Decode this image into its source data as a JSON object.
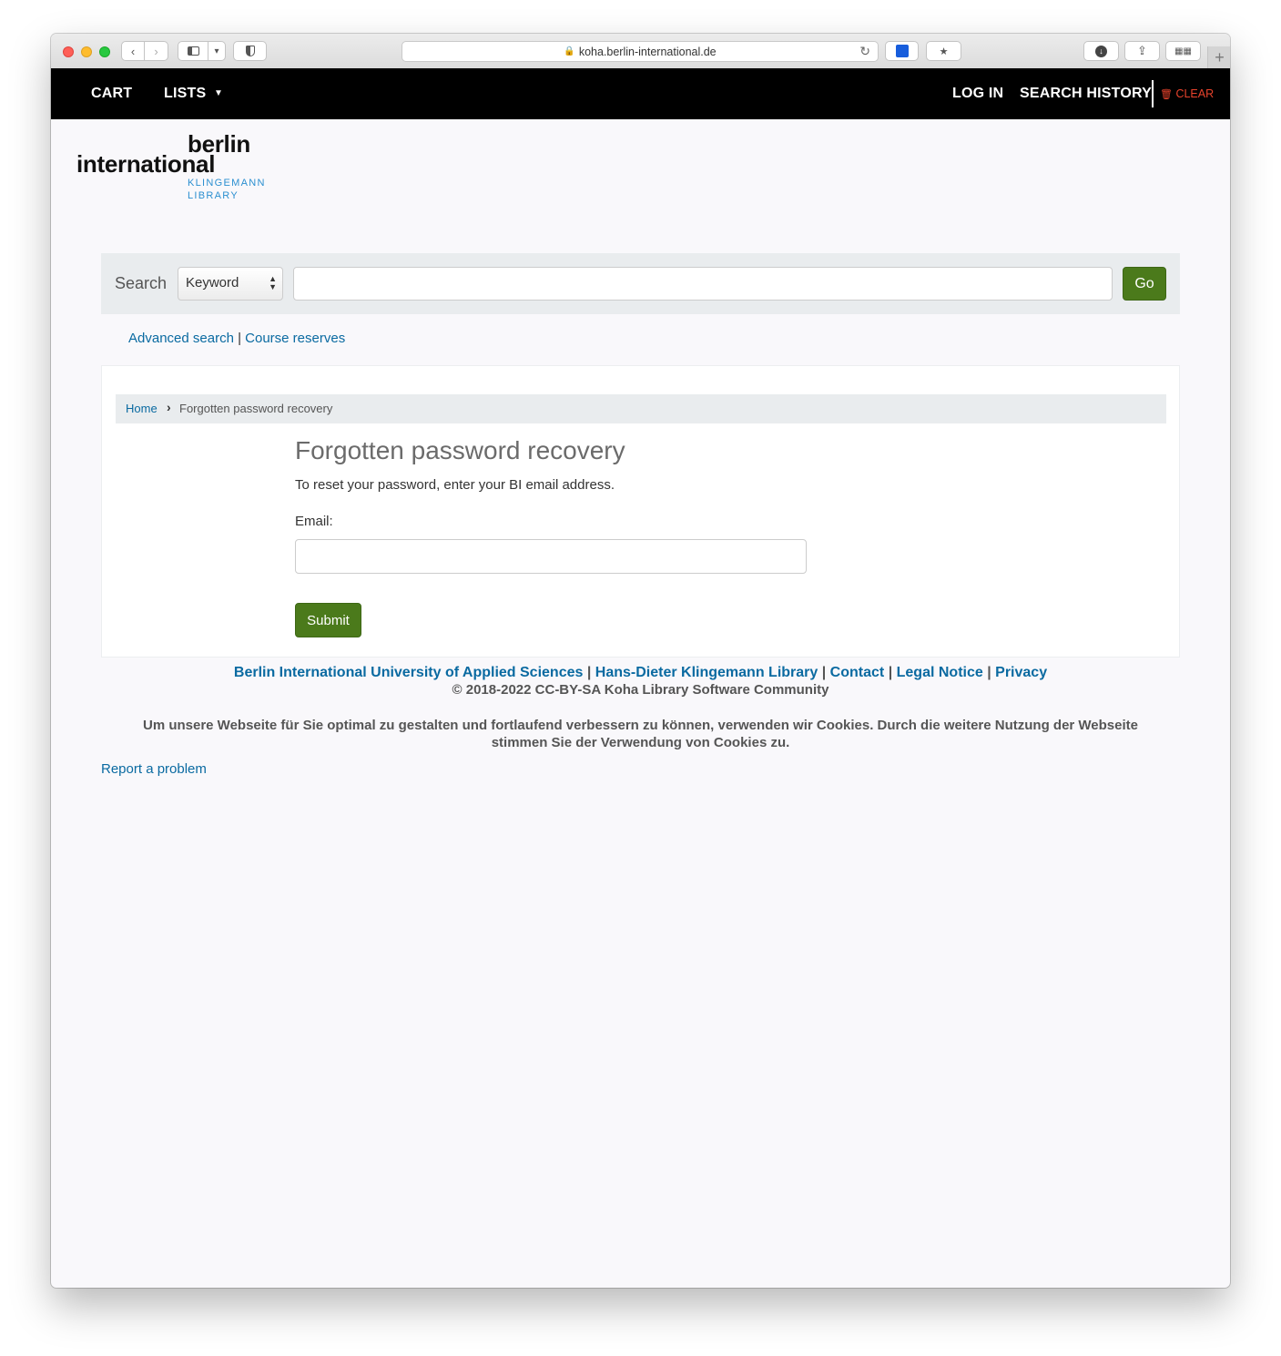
{
  "browser": {
    "url": "koha.berlin-international.de",
    "traffic_colors": [
      "#fe5f57",
      "#febc2e",
      "#28c840"
    ]
  },
  "nav": {
    "cart": "CART",
    "lists": "LISTS",
    "login": "LOG IN",
    "search_history": "SEARCH HISTORY",
    "clear": "CLEAR"
  },
  "logo": {
    "line1": "berlin",
    "line2": "international",
    "sub1": "KLINGEMANN",
    "sub2": "LIBRARY"
  },
  "search": {
    "label": "Search",
    "select_value": "Keyword",
    "input_value": "",
    "go": "Go"
  },
  "more_searches": {
    "advanced": "Advanced search",
    "separator": "|",
    "course_reserves": "Course reserves"
  },
  "breadcrumb": {
    "home": "Home",
    "current": "Forgotten password recovery"
  },
  "form": {
    "title": "Forgotten password recovery",
    "intro": "To reset your password, enter your BI email address.",
    "email_label": "Email:",
    "email_value": "",
    "submit": "Submit"
  },
  "footer": {
    "links": [
      "Berlin International University of Applied Sciences",
      "Hans-Dieter Klingemann Library",
      "Contact",
      "Legal Notice",
      "Privacy"
    ],
    "separator": "|",
    "copyright": "© 2018-2022 CC-BY-SA Koha Library Software Community",
    "cookie_notice": "Um unsere Webseite für Sie optimal zu gestalten und fortlaufend verbessern zu können, verwenden wir Cookies. Durch die weitere Nutzung der Webseite stimmen Sie der Verwendung von Cookies zu.",
    "report": "Report a problem"
  },
  "colors": {
    "accent_green": "#4b7a1b",
    "link_blue": "#0a6aa1",
    "clear_red": "#e8432c",
    "logo_blue": "#2b8fd0"
  }
}
